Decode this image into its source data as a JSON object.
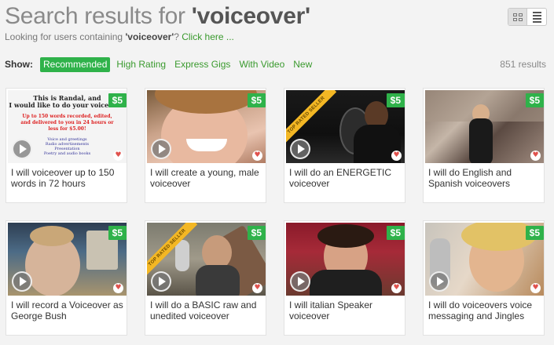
{
  "header": {
    "title_prefix": "Search results for ",
    "query_display": "'voiceover'",
    "subtitle_prefix": "Looking for users containing ",
    "subtitle_query": "'voiceover'",
    "subtitle_suffix": "? ",
    "subtitle_link": "Click here ..."
  },
  "view_toggle": {
    "grid_icon": "grid-view-icon",
    "list_icon": "list-view-icon",
    "active": "grid"
  },
  "filters": {
    "show_label": "Show:",
    "items": [
      "Recommended",
      "High Rating",
      "Express Gigs",
      "With Video",
      "New"
    ],
    "active_index": 0
  },
  "results_count": "851 results",
  "colors": {
    "accent_green": "#2fb24a",
    "link_green": "#3a9a2e",
    "ribbon_gold": "#f3b724",
    "heart_red": "#e0524d"
  },
  "gigs": [
    {
      "price": "$5",
      "title": "I will voiceover up to 150 words in 72 hours",
      "badge": "",
      "thumb_text": [
        "This is Randal, and",
        "I would like to do your voiceover.",
        "Up to 150 words recorded, edited,",
        "and delivered to you in 24 hours or",
        "less for $5.00!",
        "Voice and greetings",
        "Radio advertisements",
        "Presentation",
        "Poetry and audio books"
      ]
    },
    {
      "price": "$5",
      "title": "I will create a young, male voiceover",
      "badge": ""
    },
    {
      "price": "$5",
      "title": "I will do an ENERGETIC voiceover",
      "badge": "TOP RATED SELLER"
    },
    {
      "price": "$5",
      "title": "I will do English and Spanish voiceovers",
      "badge": ""
    },
    {
      "price": "$5",
      "title": "I will record a Voiceover as George Bush",
      "badge": ""
    },
    {
      "price": "$5",
      "title": "I will do a BASIC raw and unedited voiceover",
      "badge": "TOP RATED SELLER"
    },
    {
      "price": "$5",
      "title": "I will italian Speaker voiceover",
      "badge": ""
    },
    {
      "price": "$5",
      "title": "I will do voiceovers voice messaging and Jingles",
      "badge": ""
    }
  ]
}
